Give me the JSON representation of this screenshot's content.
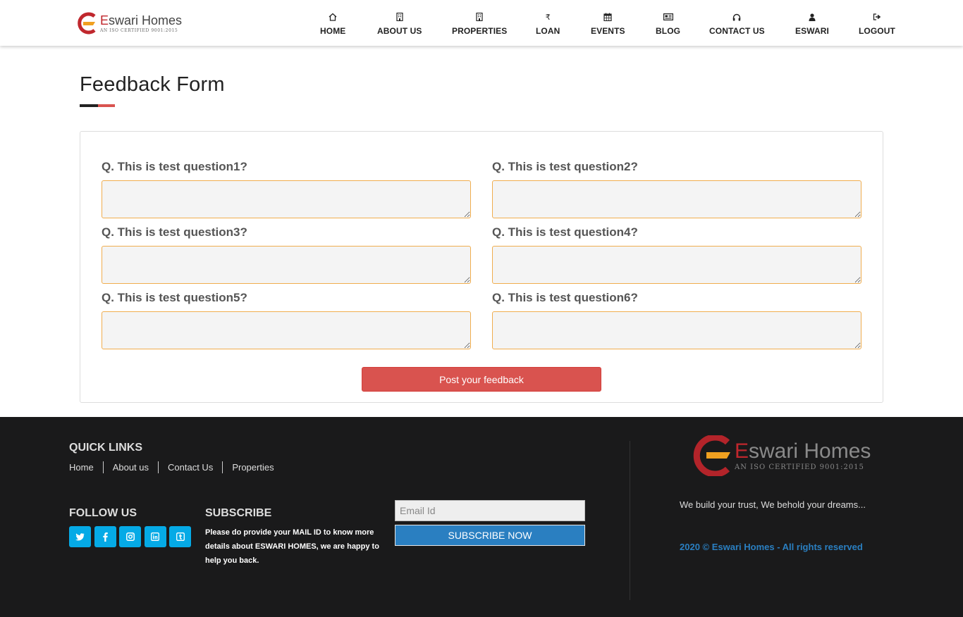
{
  "brand": {
    "name_red": "E",
    "name_rest": "swari Homes",
    "tagline": "AN ISO CERTIFIED 9001:2015"
  },
  "nav": [
    {
      "label": "HOME",
      "icon": "home-icon"
    },
    {
      "label": "ABOUT US",
      "icon": "building-icon"
    },
    {
      "label": "PROPERTIES",
      "icon": "building-icon"
    },
    {
      "label": "LOAN",
      "icon": "rupee-icon"
    },
    {
      "label": "EVENTS",
      "icon": "calendar-icon"
    },
    {
      "label": "BLOG",
      "icon": "newspaper-icon"
    },
    {
      "label": "CONTACT US",
      "icon": "headphones-icon"
    },
    {
      "label": "ESWARI",
      "icon": "user-icon"
    },
    {
      "label": "LOGOUT",
      "icon": "logout-icon"
    }
  ],
  "page": {
    "title": "Feedback Form"
  },
  "form": {
    "questions": [
      {
        "label": "Q. This is test question1?",
        "value": ""
      },
      {
        "label": "Q. This is test question2?",
        "value": ""
      },
      {
        "label": "Q. This is test question3?",
        "value": ""
      },
      {
        "label": "Q. This is test question4?",
        "value": ""
      },
      {
        "label": "Q. This is test question5?",
        "value": ""
      },
      {
        "label": "Q. This is test question6?",
        "value": ""
      }
    ],
    "submit_label": "Post your feedback"
  },
  "footer": {
    "quick_links_heading": "QUICK LINKS",
    "quick_links": [
      "Home",
      "About us",
      "Contact Us",
      "Properties"
    ],
    "follow_heading": "FOLLOW US",
    "social": [
      {
        "icon": "twitter-icon",
        "glyph": "t"
      },
      {
        "icon": "facebook-icon",
        "glyph": "f"
      },
      {
        "icon": "instagram-icon",
        "glyph": "◘"
      },
      {
        "icon": "linkedin-icon",
        "glyph": "in"
      },
      {
        "icon": "tumblr-icon",
        "glyph": "t"
      }
    ],
    "subscribe_heading": "SUBSCRIBE",
    "subscribe_text": "Please do provide your MAIL ID to know more details about ESWARI HOMES, we are happy to help you back.",
    "email_placeholder": "Email Id",
    "subscribe_button": "SUBSCRIBE NOW",
    "brand_name_red": "E",
    "brand_name_rest": "swari Homes",
    "brand_tagline": "AN ISO CERTIFIED 9001:2015",
    "tagline": "We build your trust, We behold your dreams...",
    "copyright": "2020 © Eswari Homes - All rights reserved"
  },
  "colors": {
    "accent_red": "#d9534f",
    "field_border": "#f0ad4e",
    "footer_bg": "#1a1a1b",
    "subscribe_blue": "#2a7fc1",
    "social_blue": "#05aae6"
  }
}
